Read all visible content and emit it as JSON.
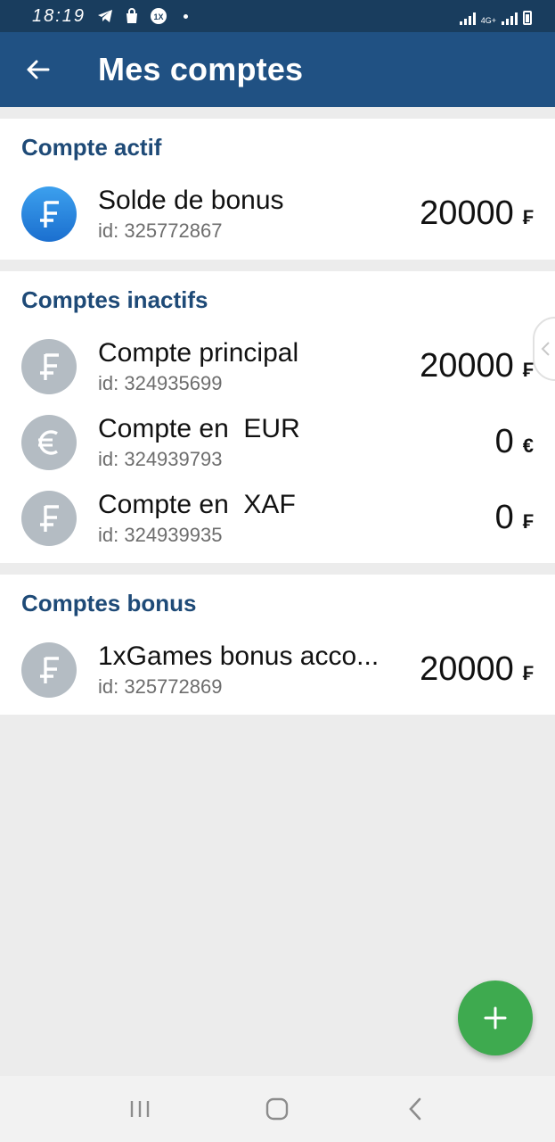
{
  "status_bar": {
    "time": "18:19",
    "network": "4G+"
  },
  "app_bar": {
    "title": "Mes comptes"
  },
  "sections": [
    {
      "header": "Compte actif",
      "accounts": [
        {
          "name": "Solde de bonus",
          "id": "id: 325772867",
          "amount": "20000",
          "currency": "₣",
          "icon": "franc-icon",
          "active": true
        }
      ]
    },
    {
      "header": "Comptes inactifs",
      "accounts": [
        {
          "name": "Compte principal",
          "id": "id: 324935699",
          "amount": "20000",
          "currency": "₣",
          "icon": "franc-icon"
        },
        {
          "name": "Compte en  EUR",
          "id": "id: 324939793",
          "amount": "0",
          "currency": "€",
          "icon": "euro-icon"
        },
        {
          "name": "Compte en  XAF",
          "id": "id: 324939935",
          "amount": "0",
          "currency": "₣",
          "icon": "franc-icon"
        }
      ]
    },
    {
      "header": "Comptes bonus",
      "accounts": [
        {
          "name": "1xGames bonus acco...",
          "id": "id: 325772869",
          "amount": "20000",
          "currency": "₣",
          "icon": "franc-icon"
        }
      ]
    }
  ],
  "colors": {
    "status_bar": "#193d5e",
    "app_bar": "#205183",
    "section_header": "#1e4a77",
    "active_avatar": "#2a86e0",
    "inactive_avatar": "#b4bcc3",
    "fab": "#3eaa4f",
    "background": "#ececec"
  }
}
